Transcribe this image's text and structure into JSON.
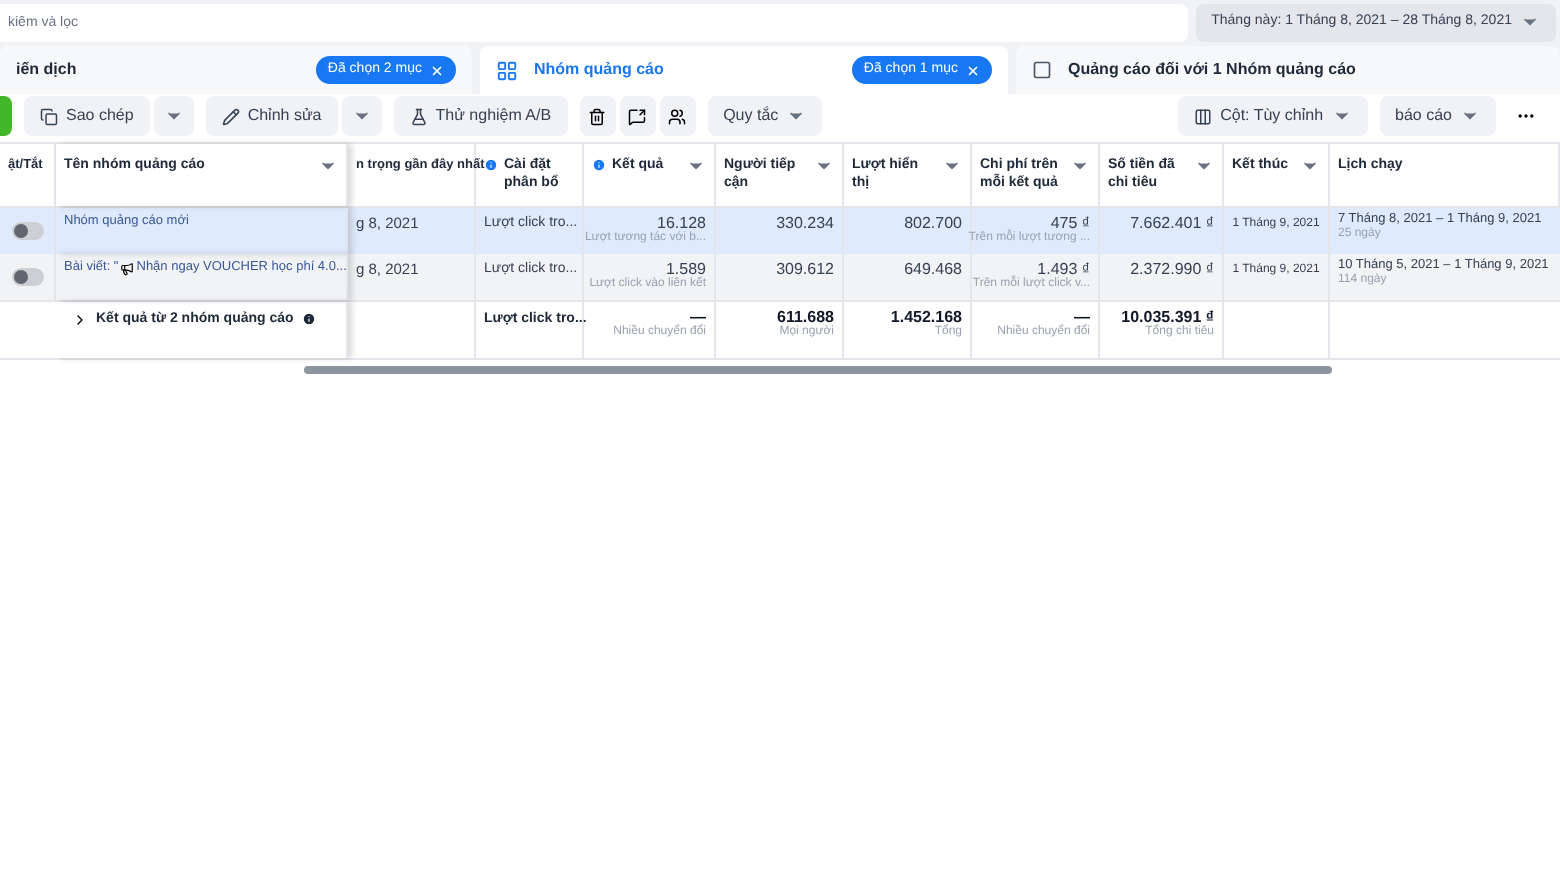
{
  "search": {
    "placeholder": "kiếm và lọc"
  },
  "date_range": {
    "label": "Tháng này: 1 Tháng 8, 2021 – 28 Tháng 8, 2021"
  },
  "tabs": [
    {
      "label": "iến dịch",
      "badge": "Đã chọn 2 mục",
      "selected": false,
      "kind": "plain"
    },
    {
      "label": "Nhóm quảng cáo",
      "badge": "Đã chọn 1 mục",
      "selected": true,
      "kind": "grid"
    },
    {
      "label": "Quảng cáo đối với 1 Nhóm quảng cáo",
      "selected": false,
      "kind": "page"
    }
  ],
  "toolbar": {
    "copy": "Sao chép",
    "edit": "Chỉnh sửa",
    "ab_test": "Thử nghiệm A/B",
    "rules": "Quy tắc",
    "columns": "Cột: Tùy chỉnh",
    "report": "báo cáo"
  },
  "table": {
    "columns": [
      {
        "label": "ật/Tắt"
      },
      {
        "label": "Tên nhóm quảng cáo"
      },
      {
        "label": "n trọng gần đây nhất"
      },
      {
        "label": "Cài đặt phân bổ",
        "info": true
      },
      {
        "label": "Kết quả",
        "info": true
      },
      {
        "label": "Người tiếp cận"
      },
      {
        "label": "Lượt hiển thị"
      },
      {
        "label": "Chi phí trên mỗi kết quả"
      },
      {
        "label": "Số tiền đã chi tiêu"
      },
      {
        "label": "Kết thúc"
      },
      {
        "label": "Lịch chạy"
      }
    ],
    "rows": [
      {
        "selected": true,
        "on": false,
        "name": "Nhóm quảng cáo mới",
        "date": "g 8, 2021",
        "setting": "Lượt click tro...",
        "result": "16.128",
        "result_sub": "Lượt tương tác với b...",
        "reach": "330.234",
        "impressions": "802.700",
        "cost": "475 ₫",
        "cost_sub": "Trên mỗi lượt tương ...",
        "spent": "7.662.401 ₫",
        "end": "1 Tháng 9, 2021",
        "schedule": "7 Tháng 8, 2021 – 1 Tháng 9, 2021",
        "schedule_sub": "25 ngày"
      },
      {
        "selected": false,
        "on": false,
        "name_prefix": "Bài viết: \"",
        "name": "Nhận ngay VOUCHER học phí 4.0...",
        "date": "g 8, 2021",
        "setting": "Lượt click tro...",
        "result": "1.589",
        "result_sub": "Lượt click vào liên kết",
        "reach": "309.612",
        "impressions": "649.468",
        "cost": "1.493 ₫",
        "cost_sub": "Trên mỗi lượt click v...",
        "spent": "2.372.990 ₫",
        "end": "1 Tháng 9, 2021",
        "schedule": "10 Tháng 5, 2021 – 1 Tháng 9, 2021",
        "schedule_sub": "114 ngày"
      }
    ],
    "total": {
      "label": "Kết quả từ 2 nhóm quảng cáo",
      "setting": "Lượt click tro...",
      "result": "—",
      "result_sub": "Nhiều chuyển đổi",
      "reach": "611.688",
      "reach_sub": "Mọi người",
      "impressions": "1.452.168",
      "impressions_sub": "Tổng",
      "cost": "—",
      "cost_sub": "Nhiều chuyển đổi",
      "spent": "10.035.391 ₫",
      "spent_sub": "Tổng chi tiêu"
    }
  }
}
